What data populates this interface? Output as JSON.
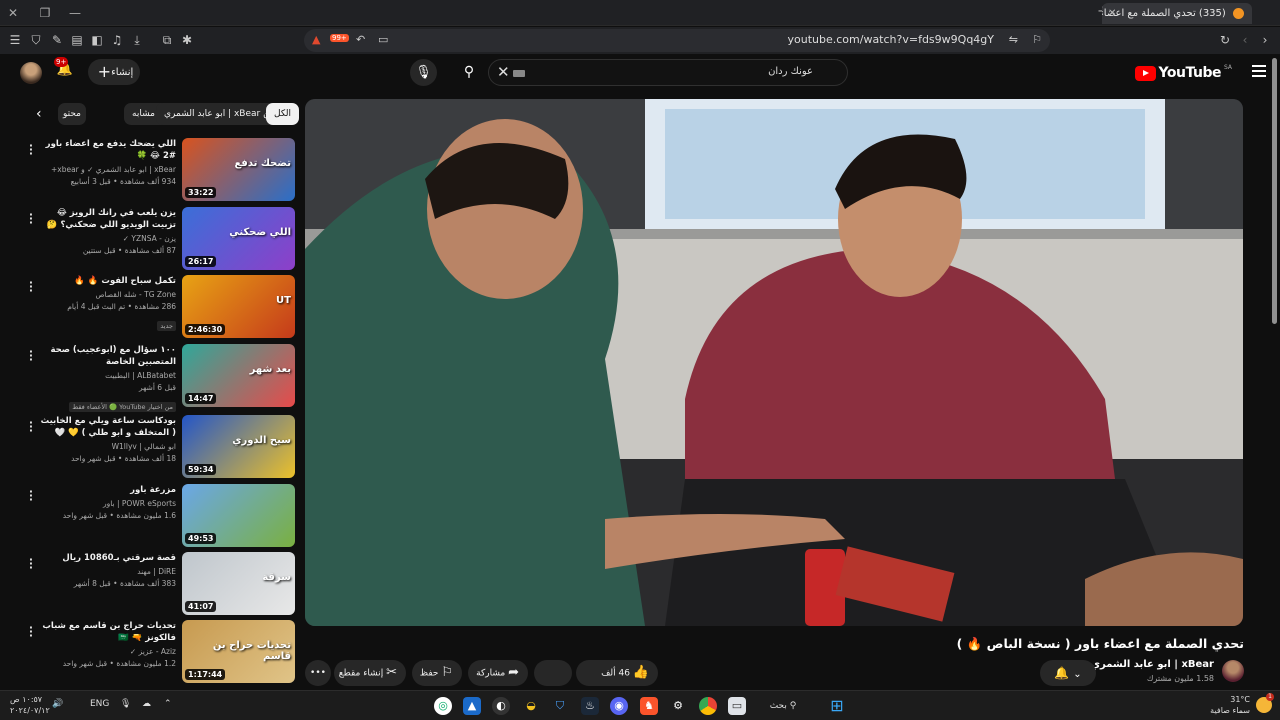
{
  "browser": {
    "tab_title": "(335) تحدي الصملة مع اعضاء",
    "url": "youtube.com/watch?v=fds9w9Qq4gY",
    "shield_count": "99+"
  },
  "youtube": {
    "logo_text": "YouTube",
    "region": "SA",
    "search_query": "عونك ردان",
    "create_label": "إنشاء",
    "notif_badge": "9+"
  },
  "chips": [
    "الكل",
    "من xBear | ابو عابد الشمري",
    "محتوى مشابه",
    "محتو"
  ],
  "recommendations": [
    {
      "title": "اللي يضحك يدفع مع اعضاء باور #2 😂 🍀",
      "channel": "xBear | ابو عابد الشمري ✓ و xbear+",
      "meta": "934 ألف مشاهدة • قبل 3 أسابيع",
      "duration": "33:22",
      "badge": "",
      "colors": [
        "#d9531e",
        "#2a6fc9"
      ],
      "thumb_text": "تضحك تدفع"
    },
    {
      "title": "يزن يلعب في رانك الرويز 😂 تزبيت الويديو اللي ضحكني؟ 🤔 #4",
      "channel": "يزن - YZNSA ✓",
      "meta": "87 ألف مشاهدة • قبل ستتين",
      "duration": "26:17",
      "badge": "",
      "colors": [
        "#3a6fd8",
        "#8e3fc9"
      ],
      "thumb_text": "اللي ضحكني"
    },
    {
      "title": "تكمل سباح الفوت 🔥 🔥",
      "channel": "TG Zone - شله القصاص",
      "meta": "286 مشاهدة • تم البث قبل 4 أيام",
      "duration": "2:46:30",
      "badge": "جديد",
      "colors": [
        "#e8a314",
        "#c53a1b"
      ],
      "thumb_text": "UT"
    },
    {
      "title": "١٠٠ سؤال مع (ابوعجيب) صحة المتصبين الخاصة",
      "channel": "ALBatabet | البطبيت",
      "meta": "قبل 6 أشهر",
      "duration": "14:47",
      "badge": "من اختيار YouTube 🟢 الأعضاء فقط",
      "colors": [
        "#2fa89a",
        "#e84a4a"
      ],
      "thumb_text": "بعد شهر"
    },
    {
      "title": "بودكاست ساعة ويلي مع الخابيث ( المتخلف و ابو طلي ) 💛 🤍",
      "channel": "ابو شمالي | W1llyv",
      "meta": "18 ألف مشاهدة • قبل شهر واحد",
      "duration": "59:34",
      "badge": "",
      "colors": [
        "#2355c8",
        "#ecc12a"
      ],
      "thumb_text": "سيح الدوري"
    },
    {
      "title": "مزرعة باور",
      "channel": "POWR eSports | باور",
      "meta": "1.6 مليون مشاهدة • قبل شهر واحد",
      "duration": "49:53",
      "badge": "",
      "colors": [
        "#6aa7e8",
        "#7ab040"
      ],
      "thumb_text": ""
    },
    {
      "title": "قصة سرقتي بـ10860 ريال",
      "channel": "DiRE | مهند",
      "meta": "383 ألف مشاهدة • قبل 8 أشهر",
      "duration": "41:07",
      "badge": "",
      "colors": [
        "#bfc6cc",
        "#e8e8e8"
      ],
      "thumb_text": "سرقة"
    },
    {
      "title": "تحديات حراج بن قاسم مع شباب فالكونز 🔫 🇸🇦",
      "channel": "Aziz - عزيز ✓",
      "meta": "1.2 مليون مشاهدة • قبل شهر واحد",
      "duration": "1:17:44",
      "badge": "",
      "colors": [
        "#c79a50",
        "#e0c488"
      ],
      "thumb_text": "تحديات حراج بن قاسم"
    }
  ],
  "video": {
    "title": "تحدي الصملة مع اعضاء باور ( نسخة الباص 🔥 )",
    "channel_name": "xBear | ابو عابد الشمري",
    "subscribers": "1.58 مليون مشترك",
    "likes": "46 ألف",
    "share_label": "مشاركة",
    "save_label": "حفظ",
    "clip_label": "إنشاء مقطع"
  },
  "taskbar": {
    "search_label": "بحث",
    "lang": "ENG",
    "time": "١٠:٥٧ ص",
    "date": "٢٠٢٤/٠٧/١٢",
    "temp": "31°C",
    "weather_text": "سماء صافية"
  }
}
